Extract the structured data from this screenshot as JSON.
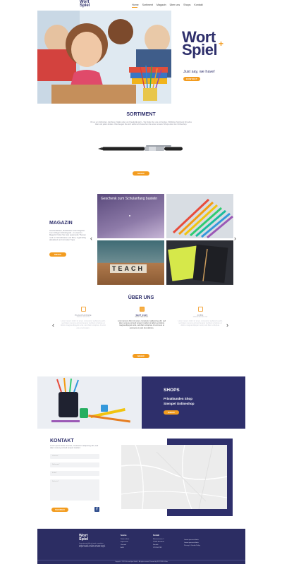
{
  "brand": {
    "logo_line1": "Wort",
    "logo_line2": "Spiel"
  },
  "nav": [
    {
      "label": "Home"
    },
    {
      "label": "Sortiment"
    },
    {
      "label": "Magazin"
    },
    {
      "label": "Über uns"
    },
    {
      "label": "Shops"
    },
    {
      "label": "Kontakt"
    }
  ],
  "hero": {
    "logo_line1": "Wort",
    "logo_line2": "Spiel",
    "tagline": "Just say, we have!",
    "button": "KONTAKT"
  },
  "sortiment": {
    "title": "SORTIMENT",
    "text": "Ob es um Schreiben, Zeichnen, Malen oder um Kreativität geht – Sie finden bei uns ein breites, fröhliches Sortiment für jedes Alter und jeden Anlass. Überzeugen Sie sich selbst und besuchen Sie einen unserer Shops oder den Onlineshop.",
    "button": "MEHR"
  },
  "magazin": {
    "title": "MAGAZIN",
    "text": "Geschenkideen, Bastelideen oder Ratgeber zum richtigen Schreibgerät – in unserem Magazin finden Sie viele spannende Themen rund um Schreibwaren und Büro, regelmäßig aktualisiert und mit vielen Tipps.",
    "button": "MEHR",
    "tile_caption": "Geschenk zum Schulanfang basteln",
    "tile_teach": "TEACH",
    "arrow_left": "‹",
    "arrow_right": "›"
  },
  "ueber": {
    "title": "ÜBER UNS",
    "cards": [
      {
        "title": "PHILOSOPHIE",
        "sub": "DAS IST WICHTIG",
        "text": "Lorem ipsum dolor sit amet, consetetur sadipscing elitr, sed diam nonumy eirmod tempor invidunt ut labore et dolore magna aliquyam erat, sed diam voluptua. At vero eos et accusam."
      },
      {
        "title": "SEIT 1915",
        "sub": "WORT UND SPIEL",
        "text": "Lorem ipsum dolor sit amet, consetetur sadipscing elitr, sed diam nonumy eirmod tempor invidunt ut labore et dolore magna aliquyam erat, sed diam voluptua. At vero eos et accusam et justo duo dolores."
      },
      {
        "title": "JOBS",
        "sub": "KARRIERE BEI UNS",
        "text": "Lorem ipsum dolor sit amet, consetetur sadipscing elitr, sed diam nonumy eirmod tempor invidunt ut labore et dolore magna aliquyam erat, sed diam voluptua."
      }
    ],
    "button": "MEHR",
    "arrow_left": "‹",
    "arrow_right": "›"
  },
  "shops": {
    "title": "SHOPS",
    "line1": "Privatkunden Shop",
    "line2": "Stempel Onlineshop",
    "button": "MEHR"
  },
  "kontakt": {
    "title": "KONTAKT",
    "text": "Lorem ipsum dolor sit amet, consetetur sadipscing elitr, sed diam nonumy eirmod tempor invidunt.",
    "fields": [
      "Vorname*",
      "Nachname*",
      "E-Mail*",
      "Nachricht*"
    ],
    "button": "SENDEN"
  },
  "footer": {
    "logo_line1": "Wort",
    "logo_line2": "Spiel",
    "about": "Lorem ipsum dolor sit amet, consetetur sadipscing elitr, sed diam nonumy eirmod tempor invidunt ut labore et dolore magna.",
    "col_service_title": "Service",
    "col_service": [
      "Datenschutz",
      "Impressum",
      "Versand",
      "AGB"
    ],
    "col_contact_title": "Kontakt",
    "col_contact": [
      "Musterstrasse 1",
      "12345 Musterort",
      "Kontakt",
      "123 456 789"
    ],
    "col_hours": [
      "Lorem ipsum et dolor",
      "Lorem ipsum et dolor",
      "Privacy & Cookie Policy"
    ],
    "copyright": "Copyright © 2021 Wort und Spiel GmbH – All rights reserved. Powered by WORTSPIEL Webs"
  },
  "colors": {
    "navy": "#2e2f6b",
    "orange": "#f39c1f",
    "footer": "#2c2d63"
  }
}
